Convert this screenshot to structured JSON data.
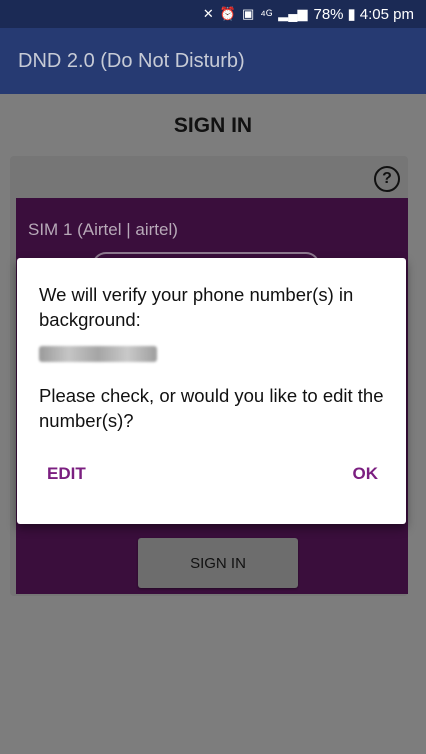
{
  "status_bar": {
    "icons": [
      "mute-icon",
      "alarm-icon",
      "sim-icon",
      "4g-icon",
      "signal-icon"
    ],
    "battery": "78%",
    "time": "4:05 pm"
  },
  "app_bar": {
    "title": "DND 2.0 (Do Not Disturb)"
  },
  "page": {
    "title": "SIGN IN",
    "sim_label": "SIM 1  (Airtel | airtel)",
    "sign_in_button": "SIGN IN"
  },
  "dialog": {
    "message": "We will verify your phone number(s) in background:",
    "phone_number": "87556605006",
    "question": "Please check, or would you like to edit the number(s)?",
    "edit_button": "EDIT",
    "ok_button": "OK"
  },
  "colors": {
    "app_bar": "#263a72",
    "dialog_button": "#7b1f80",
    "sim_panel": "#3a0e3c"
  }
}
